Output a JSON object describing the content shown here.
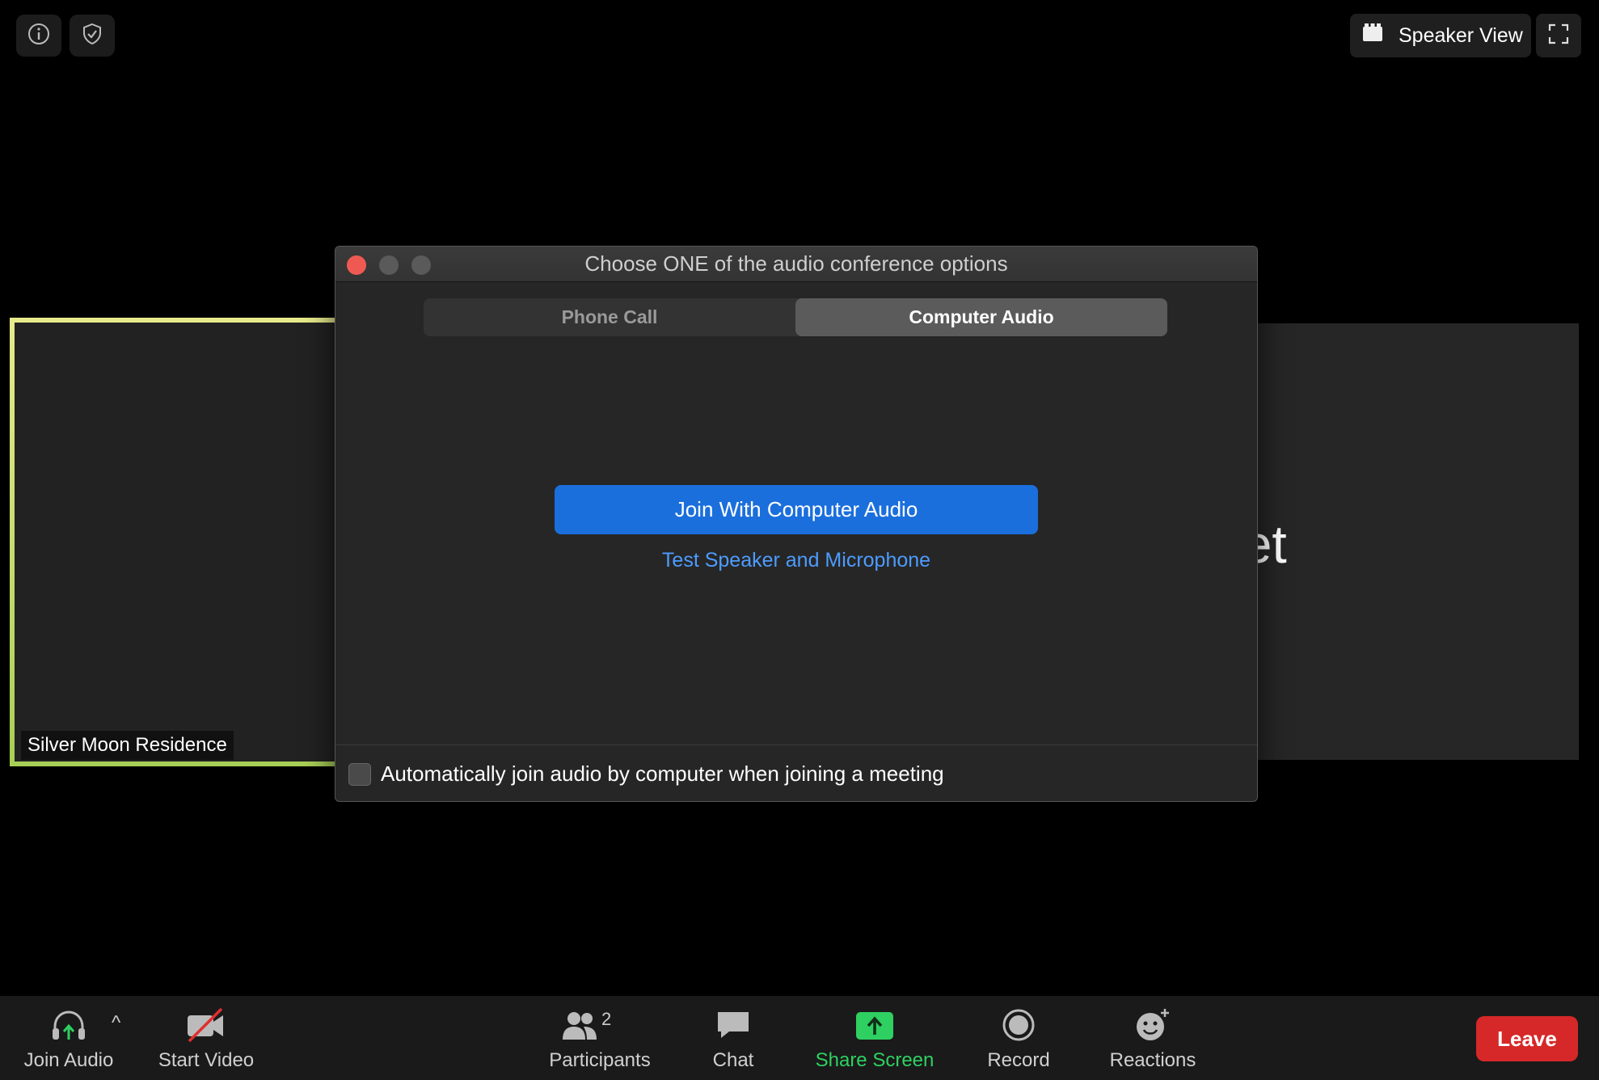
{
  "top_left": {
    "info_icon": "info-icon",
    "shield_icon": "shield-check-icon"
  },
  "top_right": {
    "view_label": "Speaker View",
    "view_icon": "grid-icon",
    "fullscreen_icon": "fullscreen-icon"
  },
  "tiles": {
    "self_name": "Silver Moon Residence",
    "other_name_visible": "aet"
  },
  "dialog": {
    "title": "Choose ONE of the audio conference options",
    "tabs": [
      {
        "label": "Phone Call",
        "active": false
      },
      {
        "label": "Computer Audio",
        "active": true
      }
    ],
    "join_button": "Join With Computer Audio",
    "test_link": "Test Speaker and Microphone",
    "auto_join_label": "Automatically join audio by computer when joining a meeting",
    "auto_join_checked": false
  },
  "toolbar": {
    "join_audio": "Join Audio",
    "audio_caret": "^",
    "start_video": "Start Video",
    "participants": "Participants",
    "participant_count": "2",
    "chat": "Chat",
    "share_screen": "Share Screen",
    "record": "Record",
    "reactions": "Reactions",
    "leave": "Leave"
  },
  "colors": {
    "accent_blue": "#1a6fdc",
    "link_blue": "#4d9cff",
    "share_green": "#2fd062",
    "leave_red": "#d62828",
    "active_speaker_border": "#e7ea8a"
  }
}
